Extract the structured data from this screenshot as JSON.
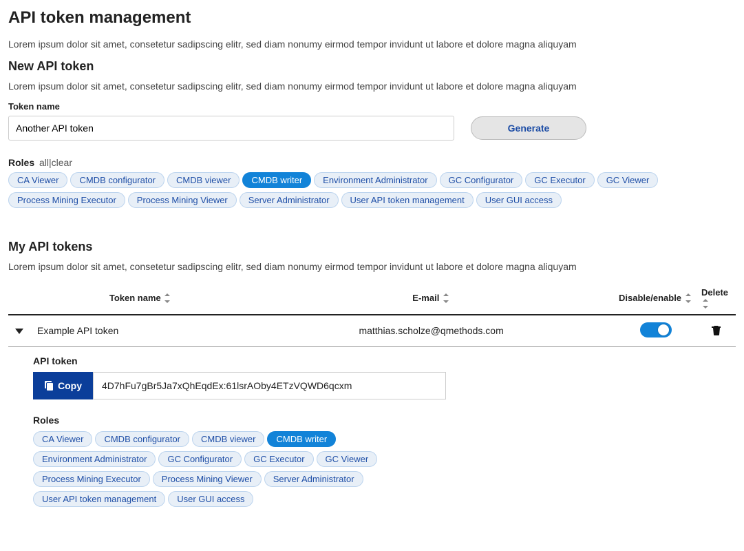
{
  "page": {
    "title": "API token management",
    "desc": "Lorem ipsum dolor sit amet, consetetur sadipscing elitr, sed diam nonumy eirmod tempor invidunt ut labore et dolore magna aliquyam"
  },
  "newToken": {
    "heading": "New API token",
    "desc": "Lorem ipsum dolor sit amet, consetetur sadipscing elitr, sed diam nonumy eirmod tempor invidunt ut labore et dolore magna aliquyam",
    "fieldLabel": "Token name",
    "fieldValue": "Another API token",
    "generate": "Generate",
    "rolesLabel": "Roles",
    "rolesAllClear": "all|clear",
    "roles": [
      {
        "name": "CA Viewer",
        "selected": false
      },
      {
        "name": "CMDB configurator",
        "selected": false
      },
      {
        "name": "CMDB viewer",
        "selected": false
      },
      {
        "name": "CMDB writer",
        "selected": true
      },
      {
        "name": "Environment Administrator",
        "selected": false
      },
      {
        "name": "GC Configurator",
        "selected": false
      },
      {
        "name": "GC Executor",
        "selected": false
      },
      {
        "name": "GC Viewer",
        "selected": false
      },
      {
        "name": "Process Mining Executor",
        "selected": false
      },
      {
        "name": "Process Mining Viewer",
        "selected": false
      },
      {
        "name": "Server Administrator",
        "selected": false
      },
      {
        "name": "User API token management",
        "selected": false
      },
      {
        "name": "User GUI access",
        "selected": false
      }
    ]
  },
  "myTokens": {
    "heading": "My API tokens",
    "desc": "Lorem ipsum dolor sit amet, consetetur sadipscing elitr, sed diam nonumy eirmod tempor invidunt ut labore et dolore magna aliquyam",
    "columns": {
      "name": "Token name",
      "email": "E-mail",
      "toggle": "Disable/enable",
      "delete": "Delete"
    },
    "row": {
      "name": "Example API token",
      "email": "matthias.scholze@qmethods.com",
      "enabled": true
    },
    "expanded": {
      "tokenLabel": "API token",
      "copy": "Copy",
      "tokenValue": "4D7hFu7gBr5Ja7xQhEqdEx:61lsrAOby4ETzVQWD6qcxm",
      "rolesLabel": "Roles",
      "roles": [
        {
          "name": "CA Viewer",
          "selected": false
        },
        {
          "name": "CMDB configurator",
          "selected": false
        },
        {
          "name": "CMDB viewer",
          "selected": false
        },
        {
          "name": "CMDB writer",
          "selected": true
        },
        {
          "name": "Environment Administrator",
          "selected": false
        },
        {
          "name": "GC Configurator",
          "selected": false
        },
        {
          "name": "GC Executor",
          "selected": false
        },
        {
          "name": "GC Viewer",
          "selected": false
        },
        {
          "name": "Process Mining Executor",
          "selected": false
        },
        {
          "name": "Process Mining Viewer",
          "selected": false
        },
        {
          "name": "Server Administrator",
          "selected": false
        },
        {
          "name": "User API token management",
          "selected": false
        },
        {
          "name": "User GUI access",
          "selected": false
        }
      ]
    }
  }
}
